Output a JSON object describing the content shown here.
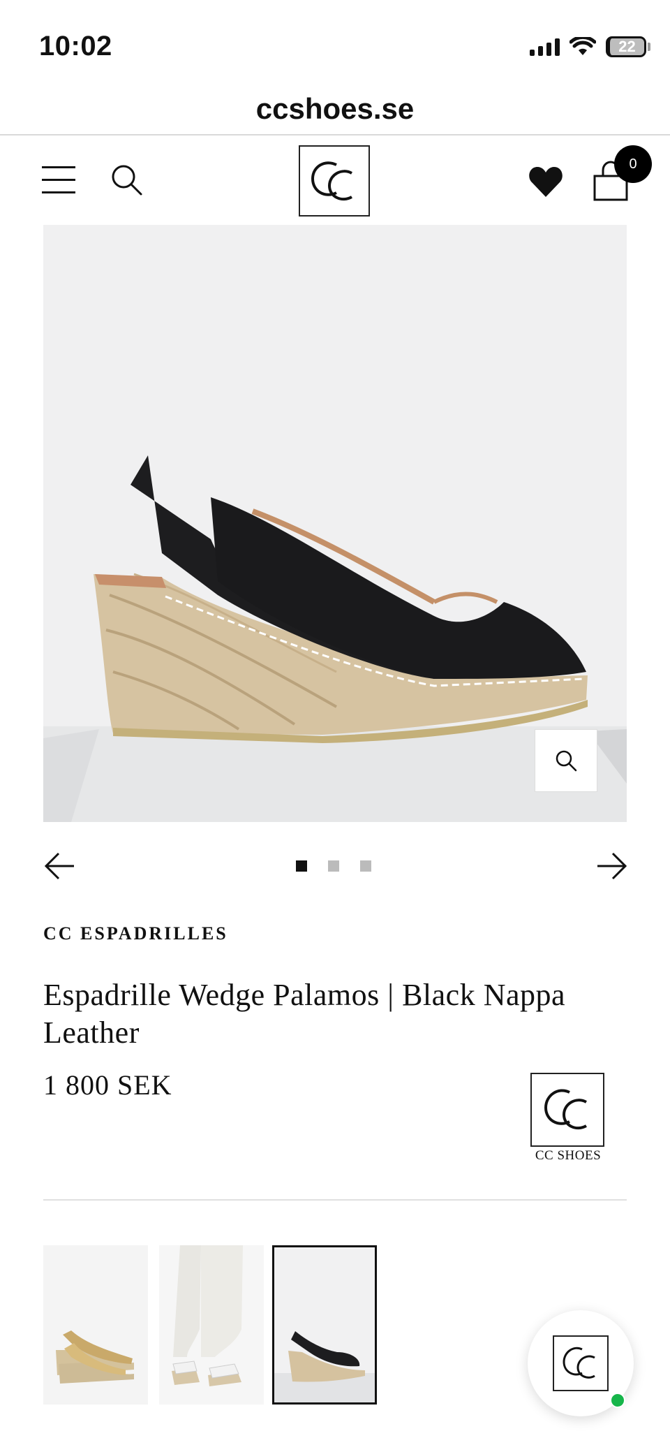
{
  "status_bar": {
    "time": "10:02",
    "battery": "22"
  },
  "browser": {
    "url": "ccshoes.se"
  },
  "header": {
    "logo_text": "CC",
    "cart_count": "0"
  },
  "gallery": {
    "slide_count": 3,
    "active_slide": 1
  },
  "product": {
    "brand": "CC ESPADRILLES",
    "title": "Espadrille Wedge Palamos | Black Nappa Leather",
    "price": "1 800 SEK",
    "brand_badge_text": "CC SHOES"
  },
  "thumbnails": [
    {
      "color": "gold",
      "selected": false
    },
    {
      "color": "white",
      "selected": false
    },
    {
      "color": "black",
      "selected": true
    }
  ],
  "colors": {
    "online": "#16b54a",
    "text": "#111111"
  }
}
